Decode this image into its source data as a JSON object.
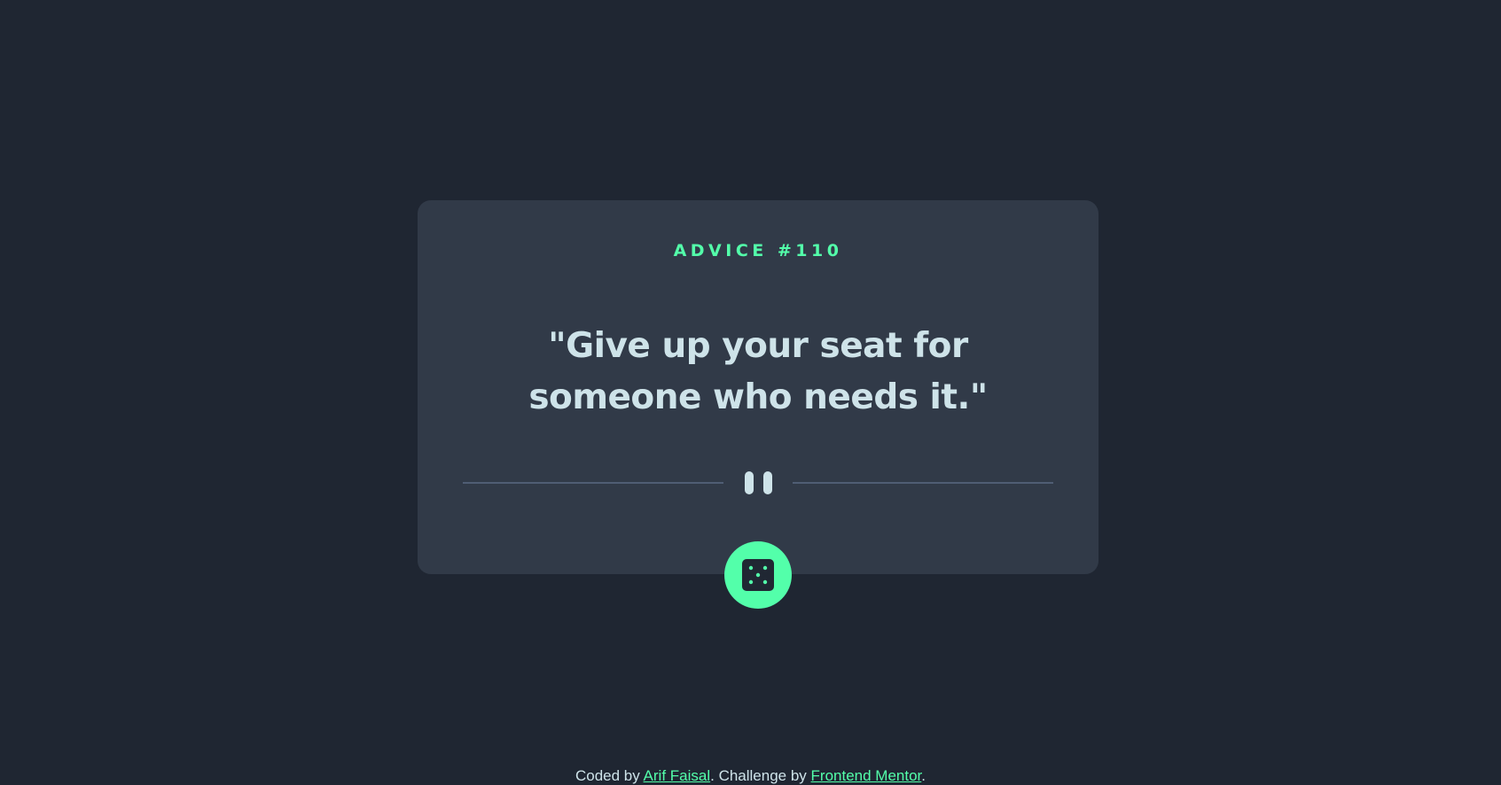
{
  "card": {
    "advice_label": "ADVICE #110",
    "quote": "\"Give up your seat for someone who needs it.\""
  },
  "divider": {
    "icon": "pause-icon"
  },
  "dice_button": {
    "icon": "dice-icon"
  },
  "footer": {
    "coded_by": "Coded by ",
    "author": "Arif Faisal",
    "challenge_by": ". Challenge by ",
    "challenge_source": "Frontend Mentor",
    "end": "."
  },
  "colors": {
    "background": "#1f2632",
    "card": "#313a48",
    "accent": "#53ffaa",
    "text": "#cee3e9",
    "divider": "#4f5d74"
  }
}
